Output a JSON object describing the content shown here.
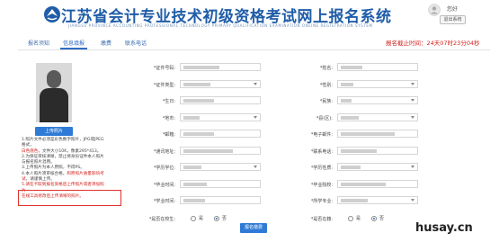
{
  "header": {
    "site_title": "江苏省会计专业技术初级资格考试网上报名系统",
    "site_subtitle": "JIANGSU PROVINCE ACCOUNTING PROFESSIONAL TECHNOLOGY PRIMARY QUALIFICATION EXAMINATION ONLINE REGISTRATION SYSTEM",
    "user_name": "您好",
    "logout_label": "退出系统"
  },
  "tabs": [
    {
      "label": "报名须知",
      "active": false
    },
    {
      "label": "信息填报",
      "active": true
    },
    {
      "label": "缴费",
      "active": false
    },
    {
      "label": "联系电话",
      "active": false
    }
  ],
  "deadline": "报名截止时间：24天07时23分04秒",
  "photo": {
    "upload_label": "上传照片",
    "notes": [
      {
        "text": "1.照片文件必须是彩色数字照片，JPG或JPEG格式，",
        "red": "",
        "tail": ""
      },
      {
        "text": "",
        "red": "白色底色",
        "tail": "，文件大小10K，像素295*413。"
      },
      {
        "text": "2.为保证审核清晰，禁止将身份证件本人照片与报名照片混用。",
        "red": "",
        "tail": ""
      },
      {
        "text": "3.上传照片为本人原照，不得PS。",
        "red": "",
        "tail": ""
      },
      {
        "text": "4.本人照片须审核合格，",
        "red": "和原照片质量影响考试",
        "tail": "，请谨慎上传。"
      },
      {
        "text": "",
        "red": "5.请在卡取到报名资格后上传照片或者添加照片",
        "tail": ""
      },
      {
        "text": "",
        "red": "在线工具修改后上传清晰的照片。",
        "tail": ""
      }
    ]
  },
  "form": {
    "fields": [
      {
        "label": "*证件号码:",
        "type": "text"
      },
      {
        "label": "*姓名:",
        "type": "text"
      },
      {
        "label": "*证件类型:",
        "type": "select"
      },
      {
        "label": "*性别:",
        "type": "select"
      },
      {
        "label": "*生日:",
        "type": "text"
      },
      {
        "label": "*民族:",
        "type": "select"
      },
      {
        "label": "*地市:",
        "type": "select"
      },
      {
        "label": "*县(区):",
        "type": "select"
      },
      {
        "label": "*邮箱:",
        "type": "text"
      },
      {
        "label": "*电子邮件:",
        "type": "text"
      },
      {
        "label": "*通讯地址:",
        "type": "text"
      },
      {
        "label": "*联系电话:",
        "type": "text"
      },
      {
        "label": "*学历学位:",
        "type": "select"
      },
      {
        "label": "*学历性质:",
        "type": "select"
      },
      {
        "label": "*毕业时间:",
        "type": "text"
      },
      {
        "label": "*毕业院校:",
        "type": "text"
      },
      {
        "label": "*学业时间:",
        "type": "text"
      },
      {
        "label": "*所学专业:",
        "type": "select"
      }
    ],
    "radio_rows": [
      {
        "label": "*是否在校生:",
        "options": [
          "是",
          "否"
        ],
        "selected": "否"
      },
      {
        "label": "*是否在籍:",
        "options": [
          "是",
          "否"
        ],
        "selected": "否"
      }
    ],
    "save_label": "报名缴费"
  },
  "watermark": "husay.cn"
}
